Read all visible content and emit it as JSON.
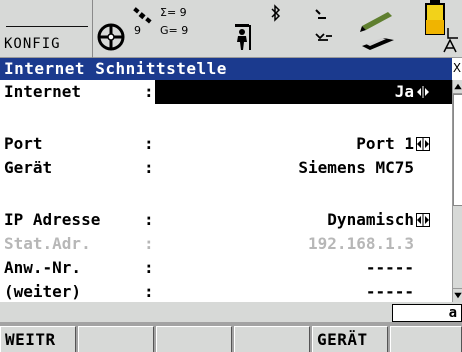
{
  "status_bar": {
    "panel_name": "KONFIG",
    "sat_gps_total": "Σ= 9",
    "sat_gps": "9",
    "sat_glonass": "G= 9",
    "icons": [
      "position-fix-icon",
      "satellite-icon",
      "rover-icon",
      "bluetooth-icon",
      "radio-icon",
      "memory-card-icon",
      "battery-icon"
    ]
  },
  "title": "Internet Schnittstelle",
  "close_glyph": "X",
  "rows": [
    {
      "label": "Internet",
      "colon": ":",
      "value": "Ja",
      "arrows": true,
      "highlight": true,
      "disabled": false
    },
    {
      "label": "Port",
      "colon": ":",
      "value": "Port 1",
      "arrows": true,
      "highlight": false,
      "disabled": false
    },
    {
      "label": "Gerät",
      "colon": ":",
      "value": "Siemens MC75",
      "arrows": false,
      "highlight": false,
      "disabled": false
    },
    {
      "label": "IP Adresse",
      "colon": ":",
      "value": "Dynamisch",
      "arrows": true,
      "highlight": false,
      "disabled": false
    },
    {
      "label": "Stat.Adr.",
      "colon": ":",
      "value": "192.168.1.3",
      "arrows": false,
      "highlight": false,
      "disabled": true
    },
    {
      "label": "Anw.-Nr.",
      "colon": ":",
      "value": "-----",
      "arrows": false,
      "highlight": false,
      "disabled": false
    },
    {
      "label": "(weiter)",
      "colon": ":",
      "value": "-----",
      "arrows": false,
      "highlight": false,
      "disabled": false
    }
  ],
  "input_mode": "a",
  "softkeys": [
    {
      "label": "WEITR"
    },
    {
      "label": ""
    },
    {
      "label": ""
    },
    {
      "label": ""
    },
    {
      "label": "GERÄT"
    },
    {
      "label": ""
    }
  ],
  "colors": {
    "title_bg": "#1b3a8e",
    "panel_bg": "#d7d9d7",
    "highlight_bg": "#000000",
    "disabled_text": "#b7b7b7"
  }
}
